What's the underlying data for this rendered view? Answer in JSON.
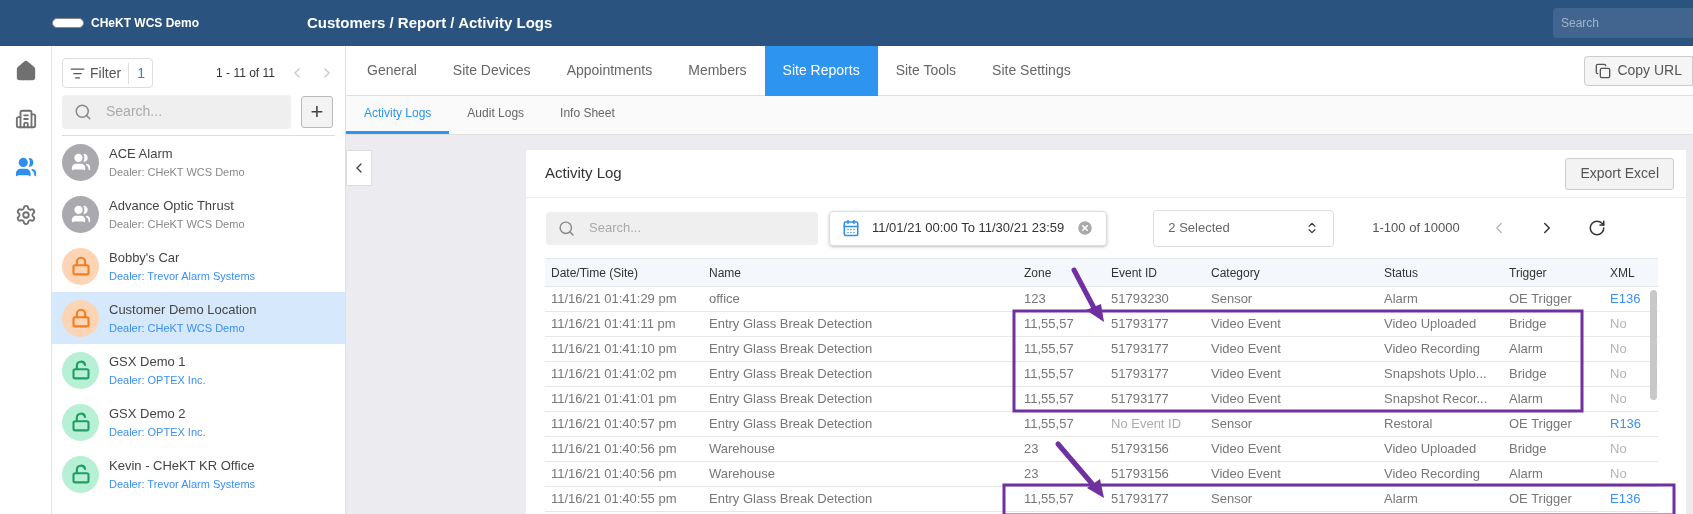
{
  "header": {
    "app_name": "CHeKT WCS Demo",
    "breadcrumb": "Customers / Report / Activity Logs",
    "search": {
      "placeholder": "Search"
    }
  },
  "rail": [
    {
      "kind": "home",
      "selected": false
    },
    {
      "kind": "building",
      "selected": false
    },
    {
      "kind": "people",
      "selected": true
    },
    {
      "kind": "settings",
      "selected": false
    }
  ],
  "customer_list": {
    "filter": {
      "label": "Filter",
      "count": "1"
    },
    "pagination": "1 - 11 of 11",
    "prev_disabled": true,
    "next_disabled": true,
    "search": {
      "placeholder": "Search..."
    },
    "add": "+",
    "items": [
      {
        "name": "ACE Alarm",
        "dealer": "Dealer: CHeKT WCS Demo",
        "kind": "group",
        "selected": false
      },
      {
        "name": "Advance Optic Thrust",
        "dealer": "Dealer: CHeKT WCS Demo",
        "kind": "group",
        "selected": false
      },
      {
        "name": "Bobby's Car",
        "dealer": "Dealer: Trevor Alarm Systems",
        "kind": "locked",
        "selected": false
      },
      {
        "name": "Customer Demo Location",
        "dealer": "Dealer: CHeKT WCS Demo",
        "kind": "locked",
        "selected": true
      },
      {
        "name": "GSX Demo 1",
        "dealer": "Dealer: OPTEX Inc.",
        "kind": "unlocked",
        "selected": false
      },
      {
        "name": "GSX Demo 2",
        "dealer": "Dealer: OPTEX Inc.",
        "kind": "unlocked",
        "selected": false
      },
      {
        "name": "Kevin - CHeKT KR Office",
        "dealer": "Dealer: Trevor Alarm Systems",
        "kind": "unlocked",
        "selected": false
      }
    ]
  },
  "tabs": [
    {
      "label": "General",
      "selected": false
    },
    {
      "label": "Site Devices",
      "selected": false
    },
    {
      "label": "Appointments",
      "selected": false
    },
    {
      "label": "Members",
      "selected": false
    },
    {
      "label": "Site Reports",
      "selected": true
    },
    {
      "label": "Site Tools",
      "selected": false
    },
    {
      "label": "Site Settings",
      "selected": false
    }
  ],
  "copy_url": "Copy URL",
  "subtabs": [
    {
      "label": "Activity Logs",
      "selected": true
    },
    {
      "label": "Audit Logs",
      "selected": false
    },
    {
      "label": "Info Sheet",
      "selected": false
    }
  ],
  "activity_log": {
    "title": "Activity Log",
    "export": "Export Excel",
    "search": {
      "placeholder": "Search..."
    },
    "date_range": "11/01/21 00:00 To 11/30/21 23:59",
    "filter": "2 Selected",
    "pagination": "1-100 of 10000",
    "prev_disabled": true,
    "next_disabled": false,
    "columns": [
      "Date/Time (Site)",
      "Name",
      "Zone",
      "Event ID",
      "Category",
      "Status",
      "Trigger",
      "XML"
    ],
    "rows": [
      {
        "date": "11/16/21 01:41:29 pm",
        "name": "office",
        "zone": "123",
        "event_id": "51793230",
        "event_id_missing": false,
        "category": "Sensor",
        "status": "Alarm",
        "trigger": "OE Trigger",
        "xml": "E136",
        "xml_link": true
      },
      {
        "date": "11/16/21 01:41:11 pm",
        "name": "Entry Glass Break Detection",
        "zone": "11,55,57",
        "event_id": "51793177",
        "event_id_missing": false,
        "category": "Video Event",
        "status": "Video Uploaded",
        "trigger": "Bridge",
        "xml": "No",
        "xml_link": false
      },
      {
        "date": "11/16/21 01:41:10 pm",
        "name": "Entry Glass Break Detection",
        "zone": "11,55,57",
        "event_id": "51793177",
        "event_id_missing": false,
        "category": "Video Event",
        "status": "Video Recording",
        "trigger": "Alarm",
        "xml": "No",
        "xml_link": false
      },
      {
        "date": "11/16/21 01:41:02 pm",
        "name": "Entry Glass Break Detection",
        "zone": "11,55,57",
        "event_id": "51793177",
        "event_id_missing": false,
        "category": "Video Event",
        "status": "Snapshots Uplo...",
        "trigger": "Bridge",
        "xml": "No",
        "xml_link": false
      },
      {
        "date": "11/16/21 01:41:01 pm",
        "name": "Entry Glass Break Detection",
        "zone": "11,55,57",
        "event_id": "51793177",
        "event_id_missing": false,
        "category": "Video Event",
        "status": "Snapshot Recor...",
        "trigger": "Alarm",
        "xml": "No",
        "xml_link": false
      },
      {
        "date": "11/16/21 01:40:57 pm",
        "name": "Entry Glass Break Detection",
        "zone": "11,55,57",
        "event_id": "No Event ID",
        "event_id_missing": true,
        "category": "Sensor",
        "status": "Restoral",
        "trigger": "OE Trigger",
        "xml": "R136",
        "xml_link": true
      },
      {
        "date": "11/16/21 01:40:56 pm",
        "name": "Warehouse",
        "zone": "23",
        "event_id": "51793156",
        "event_id_missing": false,
        "category": "Video Event",
        "status": "Video Uploaded",
        "trigger": "Bridge",
        "xml": "No",
        "xml_link": false
      },
      {
        "date": "11/16/21 01:40:56 pm",
        "name": "Warehouse",
        "zone": "23",
        "event_id": "51793156",
        "event_id_missing": false,
        "category": "Video Event",
        "status": "Video Recording",
        "trigger": "Alarm",
        "xml": "No",
        "xml_link": false
      },
      {
        "date": "11/16/21 01:40:55 pm",
        "name": "Entry Glass Break Detection",
        "zone": "11,55,57",
        "event_id": "51793177",
        "event_id_missing": false,
        "category": "Sensor",
        "status": "Alarm",
        "trigger": "OE Trigger",
        "xml": "E136",
        "xml_link": true
      }
    ]
  }
}
